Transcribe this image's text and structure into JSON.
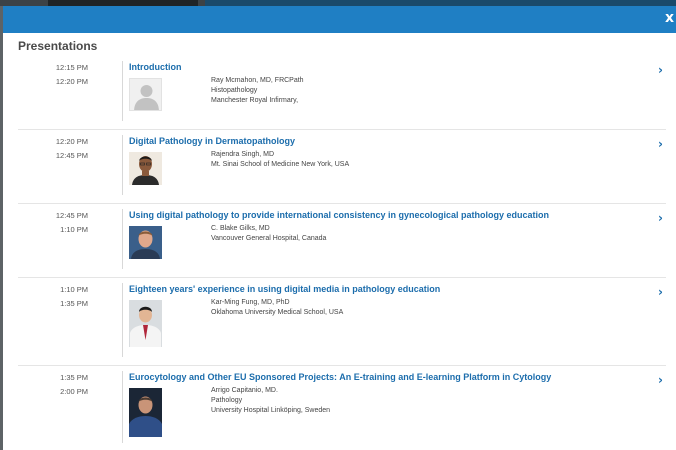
{
  "modal": {
    "close_label": "x",
    "section_title": "Presentations"
  },
  "presentations": [
    {
      "start": "12:15 PM",
      "end": "12:20 PM",
      "title": "Introduction",
      "speaker": [
        "Ray Mcmahon, MD, FRCPath",
        "Histopathology",
        "Manchester Royal Infirmary,"
      ],
      "avatar": "placeholder-avatar"
    },
    {
      "start": "12:20 PM",
      "end": "12:45 PM",
      "title": "Digital Pathology in Dermatopathology",
      "speaker": [
        "Rajendra Singh, MD",
        "Mt. Sinai School of Medicine New York, USA"
      ],
      "avatar": "speaker-photo"
    },
    {
      "start": "12:45 PM",
      "end": "1:10 PM",
      "title": "Using digital pathology to provide international consistency in gynecological pathology education",
      "speaker": [
        "C. Blake Gilks, MD",
        "Vancouver General Hospital, Canada"
      ],
      "avatar": "speaker-photo"
    },
    {
      "start": "1:10 PM",
      "end": "1:35 PM",
      "title": "Eighteen years' experience in using digital media in pathology education",
      "speaker": [
        "Kar-Ming Fung, MD, PhD",
        "Oklahoma University Medical School, USA"
      ],
      "avatar": "speaker-photo"
    },
    {
      "start": "1:35 PM",
      "end": "2:00 PM",
      "title": "Eurocytology and Other EU Sponsored Projects: An E-training and E-learning Platform in Cytology",
      "speaker": [
        "Arrigo Capitanio, MD.",
        "Pathology",
        "University Hospital Linköping, Sweden"
      ],
      "avatar": "speaker-photo"
    }
  ],
  "icons": {
    "row_action": "chevron-right-icon",
    "close": "close-icon"
  },
  "colors": {
    "header": "#1f7fc4",
    "link": "#1c6dac"
  }
}
